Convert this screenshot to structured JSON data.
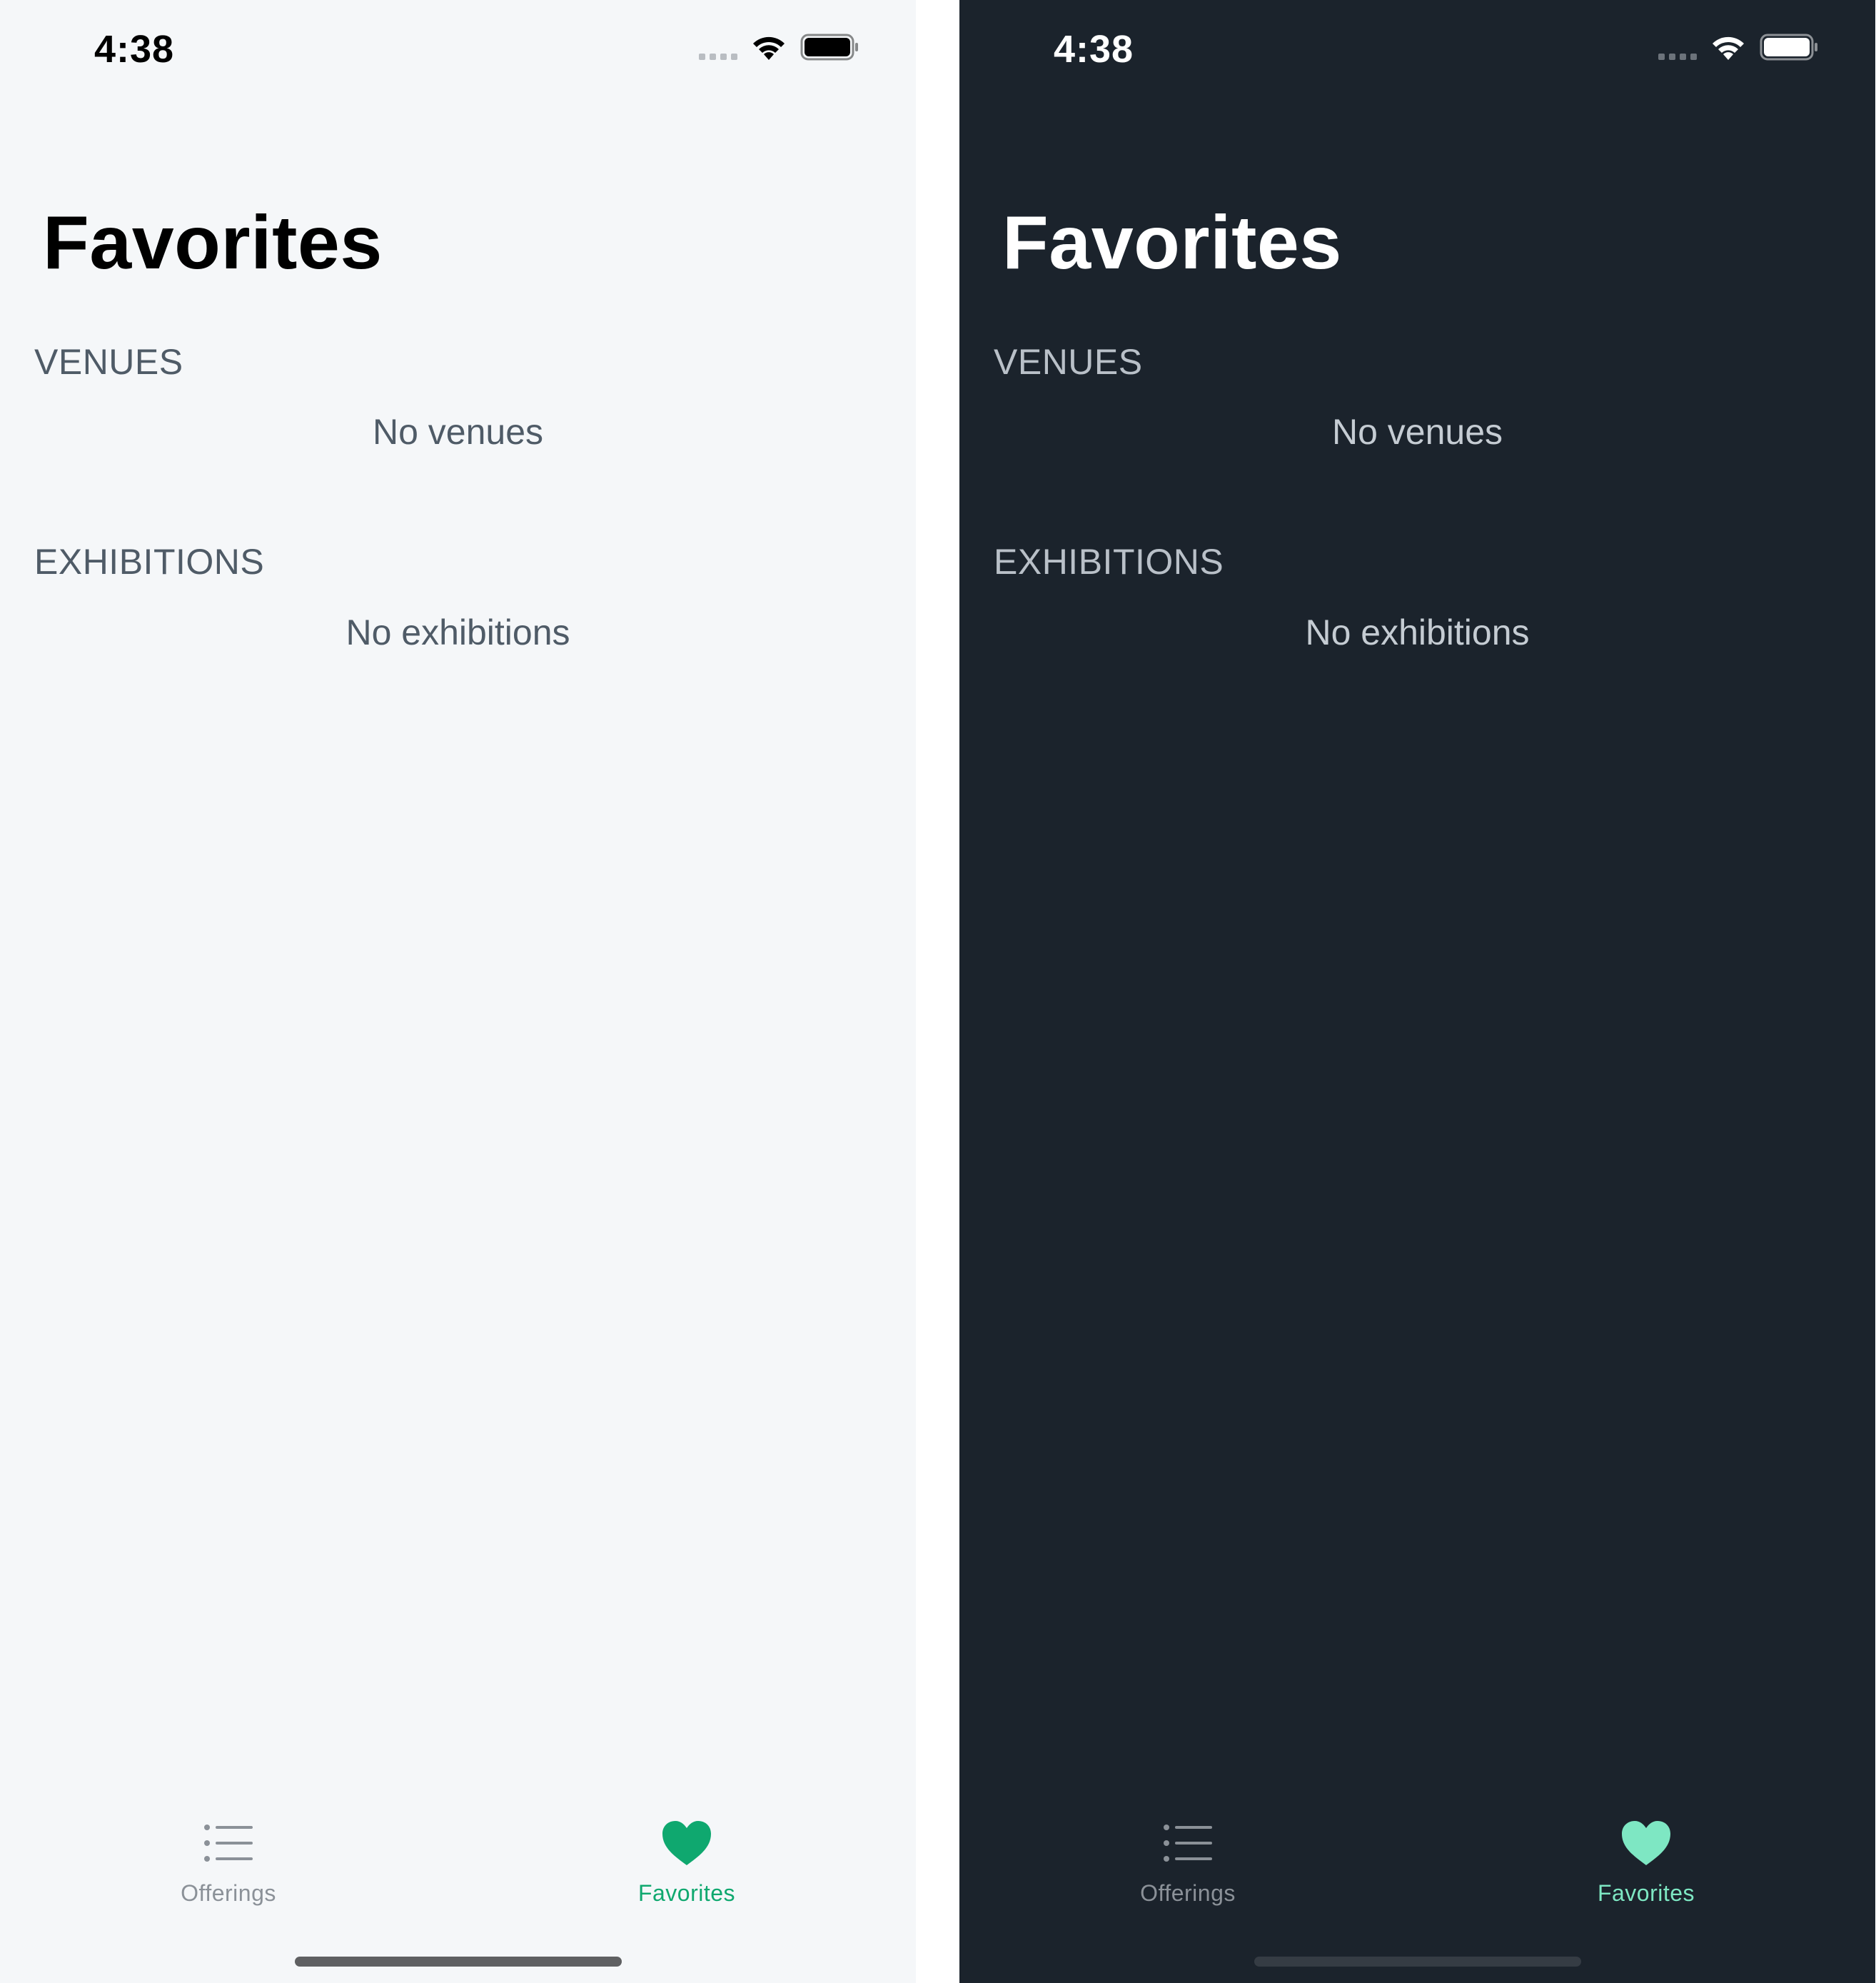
{
  "light": {
    "status_bar": {
      "time": "4:38"
    },
    "nav": {
      "title": "Favorites"
    },
    "venues": {
      "header": "VENUES",
      "empty": "No venues"
    },
    "exhibitions": {
      "header": "EXHIBITIONS",
      "empty": "No exhibitions"
    },
    "tab_bar": {
      "offerings_label": "Offerings",
      "favorites_label": "Favorites",
      "selected": "Favorites"
    }
  },
  "dark": {
    "status_bar": {
      "time": "4:38"
    },
    "nav": {
      "title": "Favorites"
    },
    "venues": {
      "header": "VENUES",
      "empty": "No venues"
    },
    "exhibitions": {
      "header": "EXHIBITIONS",
      "empty": "No exhibitions"
    },
    "tab_bar": {
      "offerings_label": "Offerings",
      "favorites_label": "Favorites",
      "selected": "Favorites"
    }
  },
  "colors": {
    "light_background": "#f5f7f9",
    "dark_background": "#1b232c",
    "light_accent": "#0fa86f",
    "dark_accent": "#7ee7c3",
    "inactive_tab": "#8b9198"
  },
  "icons": {
    "offerings_tab": "list-bullet-icon",
    "favorites_tab": "heart-icon",
    "wifi": "wifi-icon",
    "battery": "battery-icon",
    "signal": "cellular-signal-icon"
  }
}
